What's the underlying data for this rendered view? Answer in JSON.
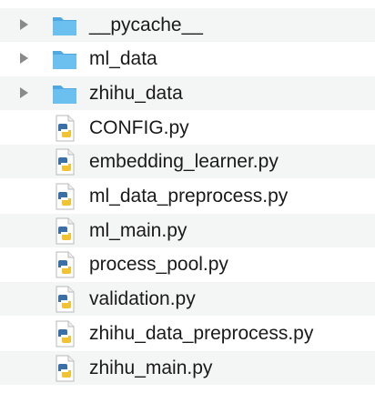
{
  "file_list": {
    "items": [
      {
        "name": "__pycache__",
        "kind": "folder",
        "icon": "folder-icon"
      },
      {
        "name": "ml_data",
        "kind": "folder",
        "icon": "folder-icon"
      },
      {
        "name": "zhihu_data",
        "kind": "folder",
        "icon": "folder-icon"
      },
      {
        "name": "CONFIG.py",
        "kind": "python",
        "icon": "python-file-icon"
      },
      {
        "name": "embedding_learner.py",
        "kind": "python",
        "icon": "python-file-icon"
      },
      {
        "name": "ml_data_preprocess.py",
        "kind": "python",
        "icon": "python-file-icon"
      },
      {
        "name": "ml_main.py",
        "kind": "python",
        "icon": "python-file-icon"
      },
      {
        "name": "process_pool.py",
        "kind": "python",
        "icon": "python-file-icon"
      },
      {
        "name": "validation.py",
        "kind": "python",
        "icon": "python-file-icon"
      },
      {
        "name": "zhihu_data_preprocess.py",
        "kind": "python",
        "icon": "python-file-icon"
      },
      {
        "name": "zhihu_main.py",
        "kind": "python",
        "icon": "python-file-icon"
      }
    ]
  },
  "colors": {
    "folder": "#62b9ec",
    "stripe": "#f4f5f5",
    "python_blue": "#3b6fa8",
    "python_yellow": "#f1c232"
  }
}
